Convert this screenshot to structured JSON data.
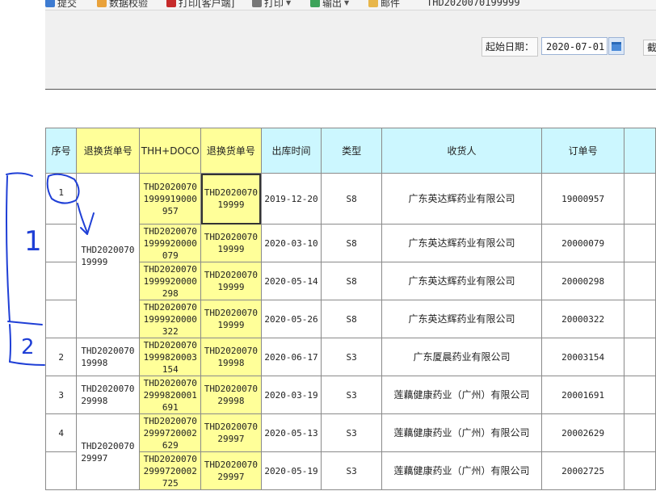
{
  "toolbar": {
    "items": [
      {
        "label": "提交",
        "icon": "submit-icon"
      },
      {
        "label": "数据校验",
        "icon": "pencil-icon"
      },
      {
        "label": "打印[客户端]",
        "icon": "pdf-print-icon"
      },
      {
        "label": "打印",
        "icon": "printer-icon"
      },
      {
        "label": "输出",
        "icon": "export-icon"
      },
      {
        "label": "邮件",
        "icon": "mail-icon"
      }
    ],
    "doc_id": "THD2020070199999"
  },
  "filter": {
    "start_label": "起始日期：",
    "start_value": "2020-07-01",
    "end_label_cut": "截"
  },
  "table": {
    "headers": [
      "序号",
      "退换货单号",
      "THH+DOCO",
      "退换货单号",
      "出库时间",
      "类型",
      "收货人",
      "订单号"
    ],
    "groups": [
      {
        "seq": "1",
        "return_no": "THD202007019999"
      },
      {
        "seq": "2",
        "return_no": "THD202007019998"
      },
      {
        "seq": "3",
        "return_no": "THD202007029998"
      },
      {
        "seq": "4",
        "return_no": "THD202007029997"
      }
    ],
    "rows": [
      {
        "doco": "THD20200701999919000957",
        "ret": "THD202007019999",
        "date": "2019-12-20",
        "type": "S8",
        "receiver": "广东英达辉药业有限公司",
        "order": "19000957"
      },
      {
        "doco": "THD20200701999920000079",
        "ret": "THD202007019999",
        "date": "2020-03-10",
        "type": "S8",
        "receiver": "广东英达辉药业有限公司",
        "order": "20000079"
      },
      {
        "doco": "THD20200701999920000298",
        "ret": "THD202007019999",
        "date": "2020-05-14",
        "type": "S8",
        "receiver": "广东英达辉药业有限公司",
        "order": "20000298"
      },
      {
        "doco": "THD20200701999920000322",
        "ret": "THD202007019999",
        "date": "2020-05-26",
        "type": "S8",
        "receiver": "广东英达辉药业有限公司",
        "order": "20000322"
      },
      {
        "doco": "THD20200701999820003154",
        "ret": "THD202007019998",
        "date": "2020-06-17",
        "type": "S3",
        "receiver": "广东厦晨药业有限公司",
        "order": "20003154"
      },
      {
        "doco": "THD20200702999820001691",
        "ret": "THD202007029998",
        "date": "2020-03-19",
        "type": "S3",
        "receiver": "莲藕健康药业（广州）有限公司",
        "order": "20001691"
      },
      {
        "doco": "THD20200702999720002629",
        "ret": "THD202007029997",
        "date": "2020-05-13",
        "type": "S3",
        "receiver": "莲藕健康药业（广州）有限公司",
        "order": "20002629"
      },
      {
        "doco": "THD20200702999720002725",
        "ret": "THD202007029997",
        "date": "2020-05-19",
        "type": "S3",
        "receiver": "莲藕健康药业（广州）有限公司",
        "order": "20002725"
      }
    ]
  },
  "annotations": {
    "mark_1": "1",
    "mark_2": "2",
    "color": "#1f3fd6"
  }
}
